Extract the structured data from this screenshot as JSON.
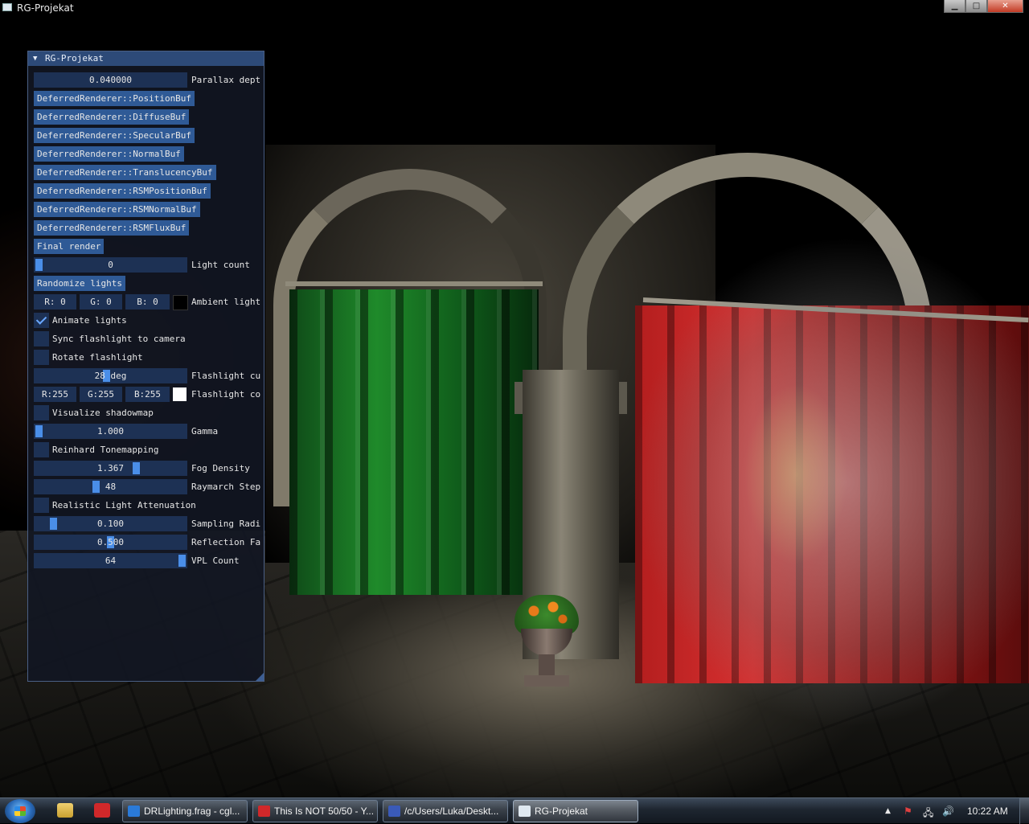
{
  "window": {
    "title": "RG-Projekat",
    "minimize_glyph": "▁",
    "maximize_glyph": "□",
    "close_glyph": "✕"
  },
  "panel": {
    "title": "RG-Projekat",
    "collapse_glyph": "▼",
    "parallax": {
      "value": "0.040000",
      "label": "Parallax dept"
    },
    "buffer_buttons": [
      "DeferredRenderer::PositionBuf",
      "DeferredRenderer::DiffuseBuf",
      "DeferredRenderer::SpecularBuf",
      "DeferredRenderer::NormalBuf",
      "DeferredRenderer::TranslucencyBuf",
      "DeferredRenderer::RSMPositionBuf",
      "DeferredRenderer::RSMNormalBuf",
      "DeferredRenderer::RSMFluxBuf"
    ],
    "final_render": "Final render",
    "light_count": {
      "value": "0",
      "label": "Light count",
      "fill": 0.0
    },
    "randomize_lights": "Randomize lights",
    "ambient": {
      "r": "R:  0",
      "g": "G:  0",
      "b": "B:  0",
      "label": "Ambient light",
      "color": "#000000"
    },
    "animate_lights": {
      "label": "Animate lights",
      "checked": true
    },
    "sync_flashlight": {
      "label": "Sync flashlight to camera",
      "checked": false
    },
    "rotate_flashlight": {
      "label": "Rotate flashlight",
      "checked": false
    },
    "flashlight_cutoff": {
      "value": "28 deg",
      "label": "Flashlight cu",
      "fill": 0.47
    },
    "flashlight_color": {
      "r": "R:255",
      "g": "G:255",
      "b": "B:255",
      "label": "Flashlight co",
      "color": "#ffffff"
    },
    "visualize_shadowmap": {
      "label": "Visualize shadowmap",
      "checked": false
    },
    "gamma": {
      "value": "1.000",
      "label": "Gamma",
      "fill": 0.0
    },
    "reinhard": {
      "label": "Reinhard Tonemapping",
      "checked": false
    },
    "fog_density": {
      "value": "1.367",
      "label": "Fog Density",
      "fill": 0.68
    },
    "raymarch_steps": {
      "value": "48",
      "label": "Raymarch Step",
      "fill": 0.4
    },
    "realistic_attenuation": {
      "label": "Realistic Light Attenuation",
      "checked": false
    },
    "sampling_radius": {
      "value": "0.100",
      "label": "Sampling Radi",
      "fill": 0.1
    },
    "reflection_factor": {
      "value": "0.500",
      "label": "Reflection Fa",
      "fill": 0.5
    },
    "vpl_count": {
      "value": "64",
      "label": "VPL Count",
      "fill": 1.0
    }
  },
  "taskbar": {
    "tasks": [
      {
        "label": "DRLighting.frag - cgl...",
        "icon_color": "#2a7ad8"
      },
      {
        "label": "This Is NOT 50/50 - Y...",
        "icon_color": "#d0282a"
      },
      {
        "label": "/c/Users/Luka/Deskt...",
        "icon_color": "#3a5ab8"
      },
      {
        "label": "RG-Projekat",
        "icon_color": "#dfe8f0"
      }
    ],
    "tray_arrow": "▲",
    "clock": "10:22 AM"
  },
  "colors": {
    "panel_bg": "#121622",
    "panel_header": "#2d4a78",
    "button": "#2f5a96",
    "frame": "#1d3154",
    "slider_grab": "#4a8ee8"
  }
}
